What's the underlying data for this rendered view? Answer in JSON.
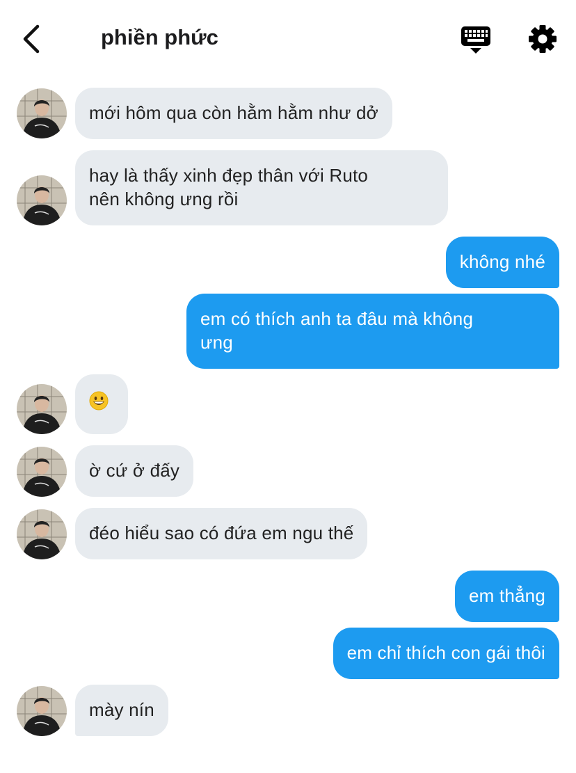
{
  "header": {
    "title": "phiền phức",
    "back_icon": "chevron-left-icon",
    "keyboard_icon": "keyboard-icon",
    "settings_icon": "gear-icon"
  },
  "colors": {
    "outgoing_bubble": "#1d9bf0",
    "incoming_bubble": "#e7ebef",
    "incoming_text": "#222222",
    "outgoing_text": "#ffffff"
  },
  "messages": [
    {
      "direction": "in",
      "lines": [
        "mới hôm qua còn hằm hằm như dở"
      ]
    },
    {
      "direction": "in",
      "lines": [
        "hay là thấy xinh đẹp thân với Ruto",
        "nên không ưng rồi"
      ]
    },
    {
      "direction": "out",
      "lines": [
        "không nhé"
      ]
    },
    {
      "direction": "out",
      "lines": [
        "em có thích anh ta đâu mà không",
        "ưng"
      ]
    },
    {
      "direction": "in",
      "emoji": "grinning-face-emoji",
      "lines": []
    },
    {
      "direction": "in",
      "lines": [
        "ờ cứ ở đấy"
      ]
    },
    {
      "direction": "in",
      "lines": [
        "đéo hiểu sao có đứa em ngu thế"
      ]
    },
    {
      "direction": "out",
      "lines": [
        "em thẳng"
      ]
    },
    {
      "direction": "out",
      "lines": [
        "em chỉ thích con gái thôi"
      ]
    },
    {
      "direction": "in",
      "lines": [
        "mày nín"
      ]
    }
  ]
}
